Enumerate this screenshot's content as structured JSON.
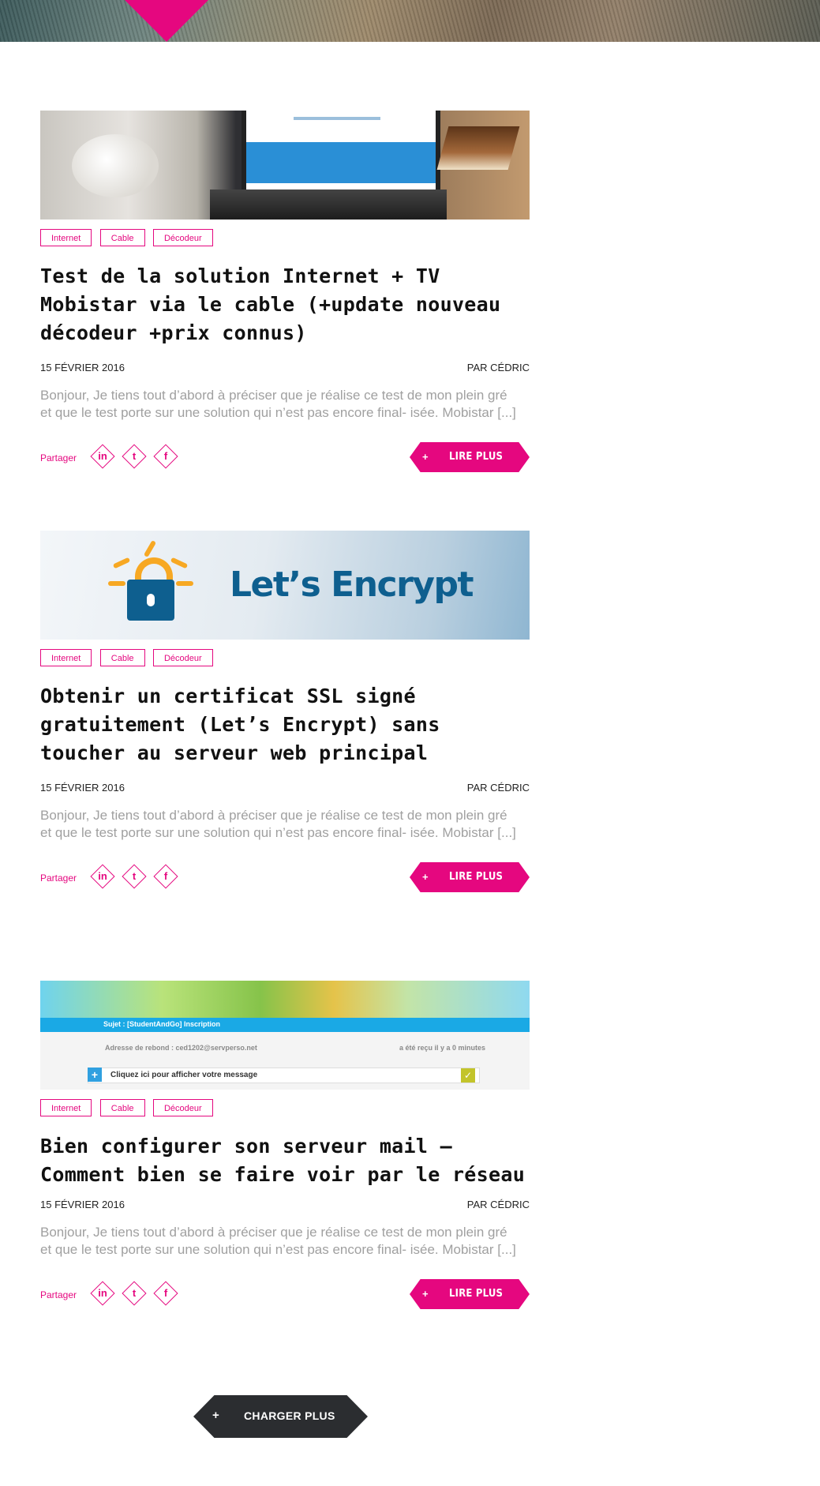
{
  "share_label": "Partager",
  "read_more_label": "LIRE PLUS",
  "read_more_plus": "+",
  "load_more": {
    "plus": "+",
    "label": "CHARGER PLUS"
  },
  "colors": {
    "accent": "#e5077f",
    "dark": "#2b2d30",
    "excerpt": "#a0a0a0"
  },
  "social_icons": [
    "linkedin-icon",
    "twitter-icon",
    "facebook-icon"
  ],
  "posts": [
    {
      "tags": [
        "Internet",
        "Cable",
        "Décodeur"
      ],
      "title": "Test de la solution Internet + TV Mobistar via le cable (+update nouveau décodeur +prix connus)",
      "date": "15 FÉVRIER 2016",
      "author": "PAR CÉDRIC",
      "excerpt": "Bonjour, Je tiens tout d’abord à préciser que je réalise ce test de mon plein gré et que le test porte sur une solution qui n’est pas encore final- isée. Mobistar [...]"
    },
    {
      "tags": [
        "Internet",
        "Cable",
        "Décodeur"
      ],
      "title": "Obtenir un certificat SSL signé gratuitement (Let’s Encrypt) sans toucher au serveur web principal",
      "date": "15 FÉVRIER 2016",
      "author": "PAR CÉDRIC",
      "excerpt": "Bonjour, Je tiens tout d’abord à préciser que je réalise ce test de mon plein gré et que le test porte sur une solution qui n’est pas encore final- isée. Mobistar [...]",
      "image_text": "Let’s Encrypt"
    },
    {
      "tags": [
        "Internet",
        "Cable",
        "Décodeur"
      ],
      "title": "Bien configurer son serveur mail – Comment bien se faire voir par le réseau",
      "date": "15 FÉVRIER 2016",
      "author": "PAR CÉDRIC",
      "excerpt": "Bonjour, Je tiens tout d’abord à préciser que je réalise ce test de mon plein gré et que le test porte sur une solution qui n’est pas encore final- isée. Mobistar [...]",
      "image_mail": {
        "subject": "Sujet : [StudentAndGo] Inscription",
        "bounce": "Adresse de rebond : ced1202@servperso.net",
        "received": "a été reçu il y a 0 minutes",
        "show_message": "Cliquez ici pour afficher votre message"
      }
    }
  ]
}
